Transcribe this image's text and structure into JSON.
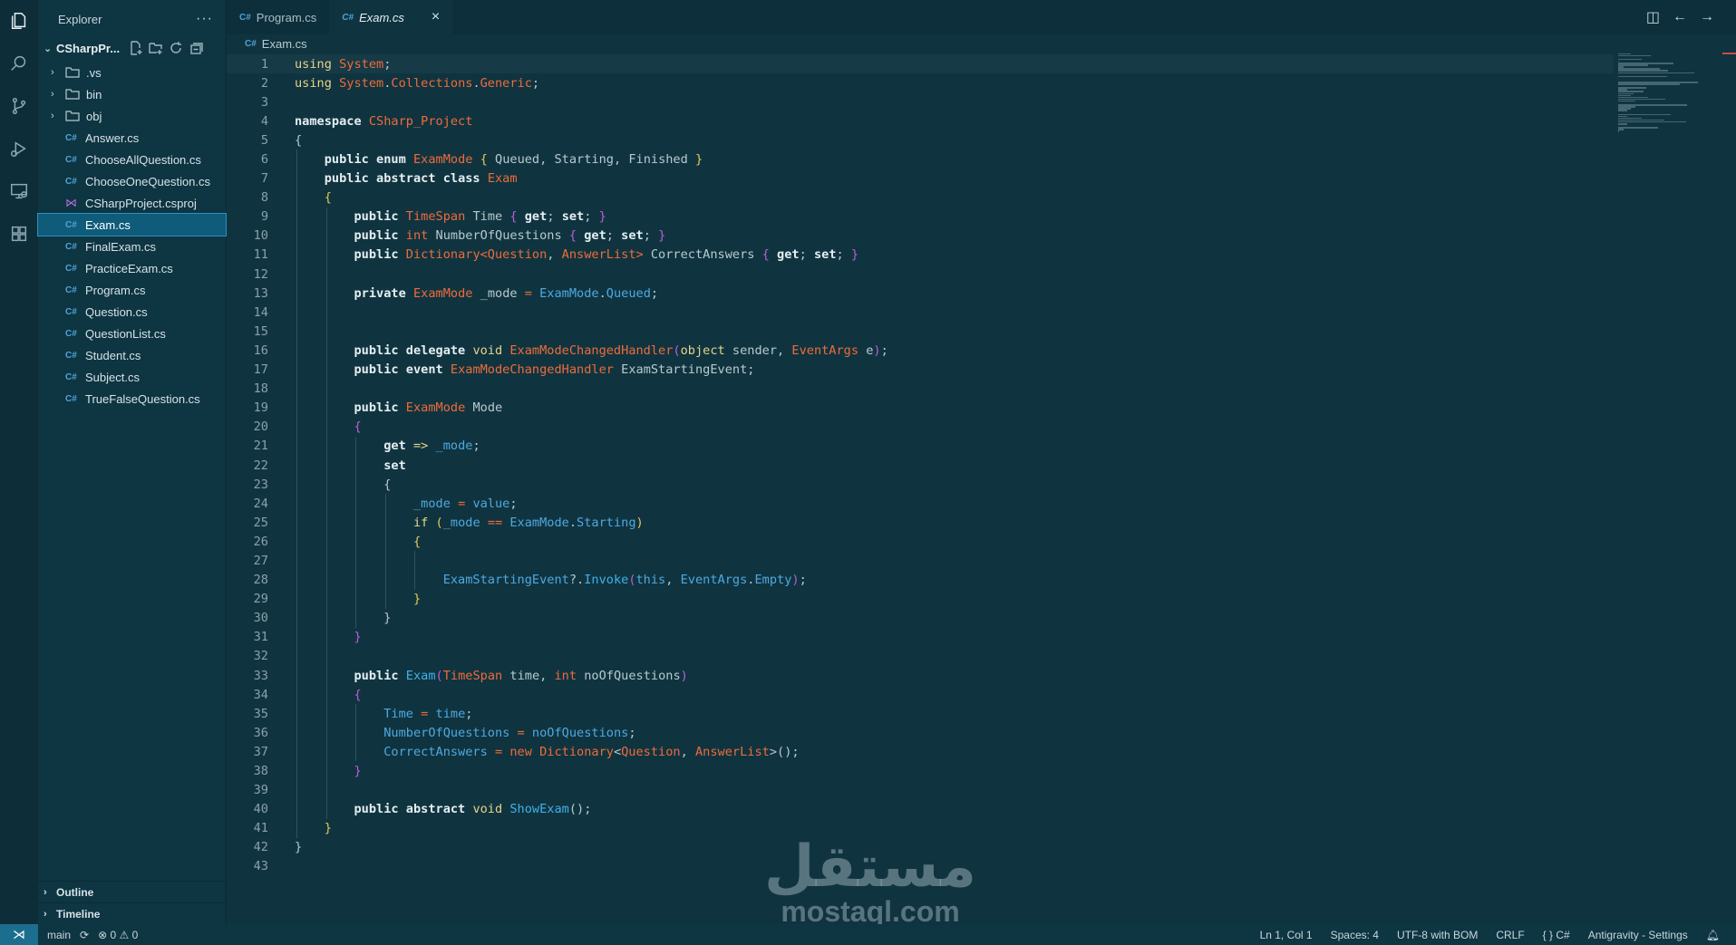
{
  "sidebar": {
    "title": "Explorer",
    "more": "···",
    "project": "CSharpPr...",
    "items": [
      {
        "type": "folder",
        "label": ".vs"
      },
      {
        "type": "folder",
        "label": "bin"
      },
      {
        "type": "folder",
        "label": "obj"
      },
      {
        "type": "cs",
        "label": "Answer.cs"
      },
      {
        "type": "cs",
        "label": "ChooseAllQuestion.cs"
      },
      {
        "type": "cs",
        "label": "ChooseOneQuestion.cs"
      },
      {
        "type": "proj",
        "label": "CSharpProject.csproj"
      },
      {
        "type": "cs",
        "label": "Exam.cs",
        "selected": true
      },
      {
        "type": "cs",
        "label": "FinalExam.cs"
      },
      {
        "type": "cs",
        "label": "PracticeExam.cs"
      },
      {
        "type": "cs",
        "label": "Program.cs"
      },
      {
        "type": "cs",
        "label": "Question.cs"
      },
      {
        "type": "cs",
        "label": "QuestionList.cs"
      },
      {
        "type": "cs",
        "label": "Student.cs"
      },
      {
        "type": "cs",
        "label": "Subject.cs"
      },
      {
        "type": "cs",
        "label": "TrueFalseQuestion.cs"
      }
    ],
    "outline": "Outline",
    "timeline": "Timeline"
  },
  "tabs": [
    {
      "lang": "C#",
      "label": "Program.cs",
      "active": false
    },
    {
      "lang": "C#",
      "label": "Exam.cs",
      "active": true
    }
  ],
  "tab_close": "×",
  "breadcrumb": {
    "lang": "C#",
    "file": "Exam.cs"
  },
  "code": [
    [
      [
        "kw2",
        "using "
      ],
      [
        "ty",
        "System"
      ],
      [
        "pu",
        ";"
      ]
    ],
    [
      [
        "kw2",
        "using "
      ],
      [
        "ty",
        "System"
      ],
      [
        "pu",
        "."
      ],
      [
        "ty",
        "Collections"
      ],
      [
        "pu",
        "."
      ],
      [
        "ty",
        "Generic"
      ],
      [
        "pu",
        ";"
      ]
    ],
    [],
    [
      [
        "kw",
        "namespace "
      ],
      [
        "ty",
        "CSharp_Project"
      ]
    ],
    [
      [
        "pu",
        "{"
      ]
    ],
    [
      [
        "pu",
        "    "
      ],
      [
        "kw",
        "public enum "
      ],
      [
        "ty",
        "ExamMode "
      ],
      [
        "br1",
        "{ "
      ],
      [
        "id",
        "Queued, Starting, Finished "
      ],
      [
        "br1",
        "}"
      ]
    ],
    [
      [
        "pu",
        "    "
      ],
      [
        "kw",
        "public abstract class "
      ],
      [
        "ty",
        "Exam"
      ]
    ],
    [
      [
        "pu",
        "    "
      ],
      [
        "br1",
        "{"
      ]
    ],
    [
      [
        "pu",
        "        "
      ],
      [
        "kw",
        "public "
      ],
      [
        "ty",
        "TimeSpan "
      ],
      [
        "id",
        "Time "
      ],
      [
        "br2",
        "{ "
      ],
      [
        "kw",
        "get"
      ],
      [
        "pu",
        "; "
      ],
      [
        "kw",
        "set"
      ],
      [
        "pu",
        "; "
      ],
      [
        "br2",
        "}"
      ]
    ],
    [
      [
        "pu",
        "        "
      ],
      [
        "kw",
        "public "
      ],
      [
        "ty",
        "int "
      ],
      [
        "id",
        "NumberOfQuestions "
      ],
      [
        "br2",
        "{ "
      ],
      [
        "kw",
        "get"
      ],
      [
        "pu",
        "; "
      ],
      [
        "kw",
        "set"
      ],
      [
        "pu",
        "; "
      ],
      [
        "br2",
        "}"
      ]
    ],
    [
      [
        "pu",
        "        "
      ],
      [
        "kw",
        "public "
      ],
      [
        "ty",
        "Dictionary<Question"
      ],
      [
        "pu",
        ", "
      ],
      [
        "ty",
        "AnswerList> "
      ],
      [
        "id",
        "CorrectAnswers "
      ],
      [
        "br2",
        "{ "
      ],
      [
        "kw",
        "get"
      ],
      [
        "pu",
        "; "
      ],
      [
        "kw",
        "set"
      ],
      [
        "pu",
        "; "
      ],
      [
        "br2",
        "}"
      ]
    ],
    [],
    [
      [
        "pu",
        "        "
      ],
      [
        "kw",
        "private "
      ],
      [
        "ty",
        "ExamMode "
      ],
      [
        "id",
        "_mode "
      ],
      [
        "ty",
        "= "
      ],
      [
        "tyb",
        "ExamMode"
      ],
      [
        "pu",
        "."
      ],
      [
        "tyb",
        "Queued"
      ],
      [
        "pu",
        ";"
      ]
    ],
    [],
    [],
    [
      [
        "pu",
        "        "
      ],
      [
        "kw",
        "public delegate "
      ],
      [
        "kw2",
        "void "
      ],
      [
        "ty",
        "ExamModeChangedHandler"
      ],
      [
        "br2",
        "("
      ],
      [
        "kw2",
        "object "
      ],
      [
        "id",
        "sender, "
      ],
      [
        "ty",
        "EventArgs "
      ],
      [
        "id",
        "e"
      ],
      [
        "br2",
        ")"
      ],
      [
        "pu",
        ";"
      ]
    ],
    [
      [
        "pu",
        "        "
      ],
      [
        "kw",
        "public event "
      ],
      [
        "ty",
        "ExamModeChangedHandler "
      ],
      [
        "id",
        "ExamStartingEvent;"
      ]
    ],
    [],
    [
      [
        "pu",
        "        "
      ],
      [
        "kw",
        "public "
      ],
      [
        "ty",
        "ExamMode "
      ],
      [
        "id",
        "Mode"
      ]
    ],
    [
      [
        "pu",
        "        "
      ],
      [
        "br2",
        "{"
      ]
    ],
    [
      [
        "pu",
        "            "
      ],
      [
        "kw",
        "get "
      ],
      [
        "kw2",
        "=> "
      ],
      [
        "tyb",
        "_mode"
      ],
      [
        "pu",
        ";"
      ]
    ],
    [
      [
        "pu",
        "            "
      ],
      [
        "kw",
        "set"
      ]
    ],
    [
      [
        "pu",
        "            "
      ],
      [
        "pu",
        "{"
      ]
    ],
    [
      [
        "pu",
        "                "
      ],
      [
        "tyb",
        "_mode "
      ],
      [
        "ty",
        "= "
      ],
      [
        "tyb",
        "value"
      ],
      [
        "pu",
        ";"
      ]
    ],
    [
      [
        "pu",
        "                "
      ],
      [
        "kw2",
        "if "
      ],
      [
        "br1",
        "("
      ],
      [
        "tyb",
        "_mode "
      ],
      [
        "ty",
        "== "
      ],
      [
        "tyb",
        "ExamMode"
      ],
      [
        "pu",
        "."
      ],
      [
        "tyb",
        "Starting"
      ],
      [
        "br1",
        ")"
      ]
    ],
    [
      [
        "pu",
        "                "
      ],
      [
        "br1",
        "{"
      ]
    ],
    [],
    [
      [
        "pu",
        "                    "
      ],
      [
        "tyb",
        "ExamStartingEvent"
      ],
      [
        "pu",
        "?."
      ],
      [
        "fn",
        "Invoke"
      ],
      [
        "br2",
        "("
      ],
      [
        "tyb",
        "this"
      ],
      [
        "pu",
        ", "
      ],
      [
        "tyb",
        "EventArgs"
      ],
      [
        "pu",
        "."
      ],
      [
        "tyb",
        "Empty"
      ],
      [
        "br2",
        ")"
      ],
      [
        "pu",
        ";"
      ]
    ],
    [
      [
        "pu",
        "                "
      ],
      [
        "br1",
        "}"
      ]
    ],
    [
      [
        "pu",
        "            "
      ],
      [
        "pu",
        "}"
      ]
    ],
    [
      [
        "pu",
        "        "
      ],
      [
        "br2",
        "}"
      ]
    ],
    [],
    [
      [
        "pu",
        "        "
      ],
      [
        "kw",
        "public "
      ],
      [
        "fn",
        "Exam"
      ],
      [
        "br2",
        "("
      ],
      [
        "ty",
        "TimeSpan "
      ],
      [
        "id",
        "time, "
      ],
      [
        "ty",
        "int "
      ],
      [
        "id",
        "noOfQuestions"
      ],
      [
        "br2",
        ")"
      ]
    ],
    [
      [
        "pu",
        "        "
      ],
      [
        "br2",
        "{"
      ]
    ],
    [
      [
        "pu",
        "            "
      ],
      [
        "tyb",
        "Time "
      ],
      [
        "ty",
        "= "
      ],
      [
        "tyb",
        "time"
      ],
      [
        "pu",
        ";"
      ]
    ],
    [
      [
        "pu",
        "            "
      ],
      [
        "tyb",
        "NumberOfQuestions "
      ],
      [
        "ty",
        "= "
      ],
      [
        "tyb",
        "noOfQuestions"
      ],
      [
        "pu",
        ";"
      ]
    ],
    [
      [
        "pu",
        "            "
      ],
      [
        "tyb",
        "CorrectAnswers "
      ],
      [
        "ty",
        "= new "
      ],
      [
        "ty",
        "Dictionary"
      ],
      [
        "pu",
        "<"
      ],
      [
        "ty",
        "Question"
      ],
      [
        "pu",
        ", "
      ],
      [
        "ty",
        "AnswerList"
      ],
      [
        "pu",
        ">();"
      ]
    ],
    [
      [
        "pu",
        "        "
      ],
      [
        "br2",
        "}"
      ]
    ],
    [],
    [
      [
        "pu",
        "        "
      ],
      [
        "kw",
        "public abstract "
      ],
      [
        "kw2",
        "void "
      ],
      [
        "fn",
        "ShowExam"
      ],
      [
        "pu",
        "();"
      ]
    ],
    [
      [
        "pu",
        "    "
      ],
      [
        "br1",
        "}"
      ]
    ],
    [
      [
        "pu",
        "}"
      ]
    ],
    []
  ],
  "watermark": {
    "arabic": "مستقل",
    "latin": "mostaql.com"
  },
  "status": {
    "branch": "main",
    "errors": "0",
    "warnings": "0",
    "position": "Ln 1, Col 1",
    "spaces": "Spaces: 4",
    "encoding": "UTF-8 with BOM",
    "eol": "CRLF",
    "language": "C#",
    "settings": "Antigravity - Settings"
  },
  "icons": [
    "files-icon",
    "search-icon",
    "source-control-icon",
    "run-debug-icon",
    "remote-explorer-icon",
    "extensions-icon"
  ]
}
